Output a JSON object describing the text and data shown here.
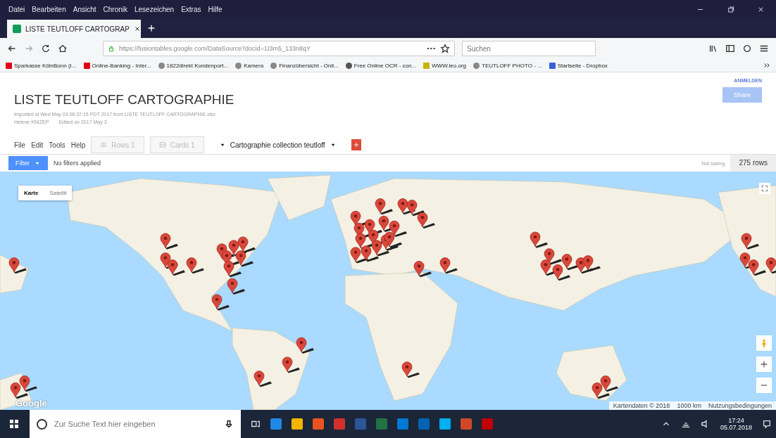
{
  "browser": {
    "menu": [
      "Datei",
      "Bearbeiten",
      "Ansicht",
      "Chronik",
      "Lesezeichen",
      "Extras",
      "Hilfe"
    ],
    "tabs": [
      {
        "title": "LISTE TEUTLOFF CARTOGRAP",
        "selected": true
      }
    ],
    "url": {
      "host": "https://fusiontables.google.com",
      "path": "/DataSource?docid=1I3m5_133n8qY"
    },
    "search": {
      "placeholder": "Suchen"
    },
    "bookmarks": [
      {
        "label": "Sparkasse KölnBonn (I...",
        "kind": "bank"
      },
      {
        "label": "Online-Banking - Inter...",
        "kind": "bank"
      },
      {
        "label": "1822direkt Kundenport...",
        "kind": "globe"
      },
      {
        "label": "Kamera",
        "kind": "globe"
      },
      {
        "label": "Finanzübersicht - Onli...",
        "kind": "globe"
      },
      {
        "label": "Free Online OCR - con...",
        "kind": "dot"
      },
      {
        "label": "WWW.leo.org",
        "kind": "leo"
      },
      {
        "label": "TEUTLOFF PHOTO - ...",
        "kind": "globe"
      },
      {
        "label": "Startseite - Dropbox",
        "kind": "dropbox"
      }
    ]
  },
  "page": {
    "title": "LISTE TEUTLOFF CARTOGRAPHIE",
    "imported": "Imported at Wed May 03 08:37:15 PDT 2017 from LISTE TEUTLOFF CARTOGRAPHIE.xlsx",
    "owner": "Helene KNIZEP",
    "edited": "Edited on 2017 May 3",
    "sign_in": "ANMELDEN",
    "share": "Share",
    "menu": [
      "File",
      "Edit",
      "Tools",
      "Help"
    ],
    "tabs": [
      {
        "label": "Rows 1",
        "kind": "rows",
        "selected": false
      },
      {
        "label": "Cards 1",
        "kind": "cards",
        "selected": false
      },
      {
        "label": "Cartographie collection teutloff",
        "kind": "map",
        "selected": true
      }
    ],
    "filter": {
      "button": "Filter",
      "status": "No filters applied",
      "saving": "Not saving",
      "rows": "275 rows"
    },
    "map": {
      "types": [
        {
          "label": "Karte",
          "selected": true
        },
        {
          "label": "Satellit",
          "selected": false
        }
      ],
      "logo": "Google",
      "attribution": "Kartendaten © 2018",
      "scale": "1000 km",
      "terms": "Nutzungsbedingungen"
    }
  },
  "taskbar": {
    "search": {
      "placeholder": "Zur Suche Text hier eingeben"
    },
    "time": "17:24",
    "date": "05.07.2018"
  }
}
